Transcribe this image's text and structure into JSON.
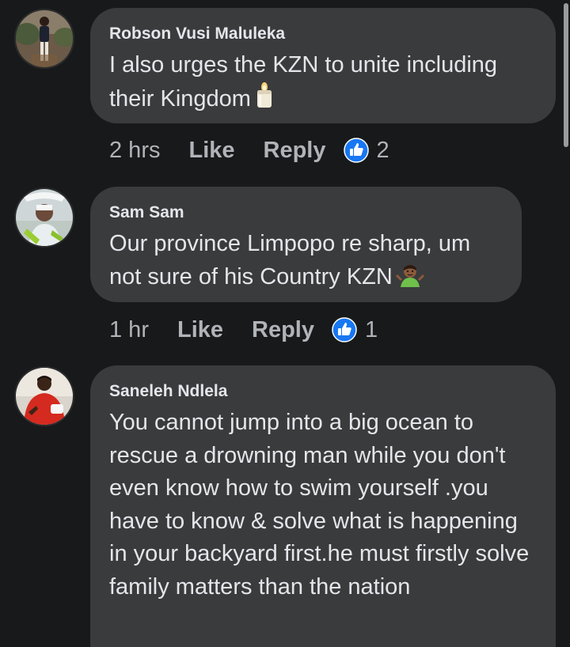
{
  "colors": {
    "background": "#18191a",
    "bubble": "#3a3b3c",
    "text_primary": "#e4e6eb",
    "text_secondary": "#b0b3b8",
    "like_blue": "#1877f2"
  },
  "comments": [
    {
      "author": "Robson Vusi Maluleka",
      "text": "I also urges the KZN to unite including their Kingdom",
      "emoji": "candle-emoji",
      "time": "2 hrs",
      "like_label": "Like",
      "reply_label": "Reply",
      "like_count": "2",
      "avatar": "avatar-person-standing"
    },
    {
      "author": "Sam Sam",
      "text": "Our province Limpopo re sharp, um not sure of his Country KZN",
      "emoji": "person-shrugging-emoji",
      "time": "1 hr",
      "like_label": "Like",
      "reply_label": "Reply",
      "like_count": "1",
      "avatar": "avatar-person-in-hat"
    },
    {
      "author": "Saneleh Ndlela",
      "text": "You cannot jump into a big ocean to rescue a drowning man while you don't even know how to swim yourself .you have to know & solve what is happening in your backyard first.he must firstly solve family matters than the nation",
      "avatar": "avatar-person-red-shirt"
    }
  ]
}
